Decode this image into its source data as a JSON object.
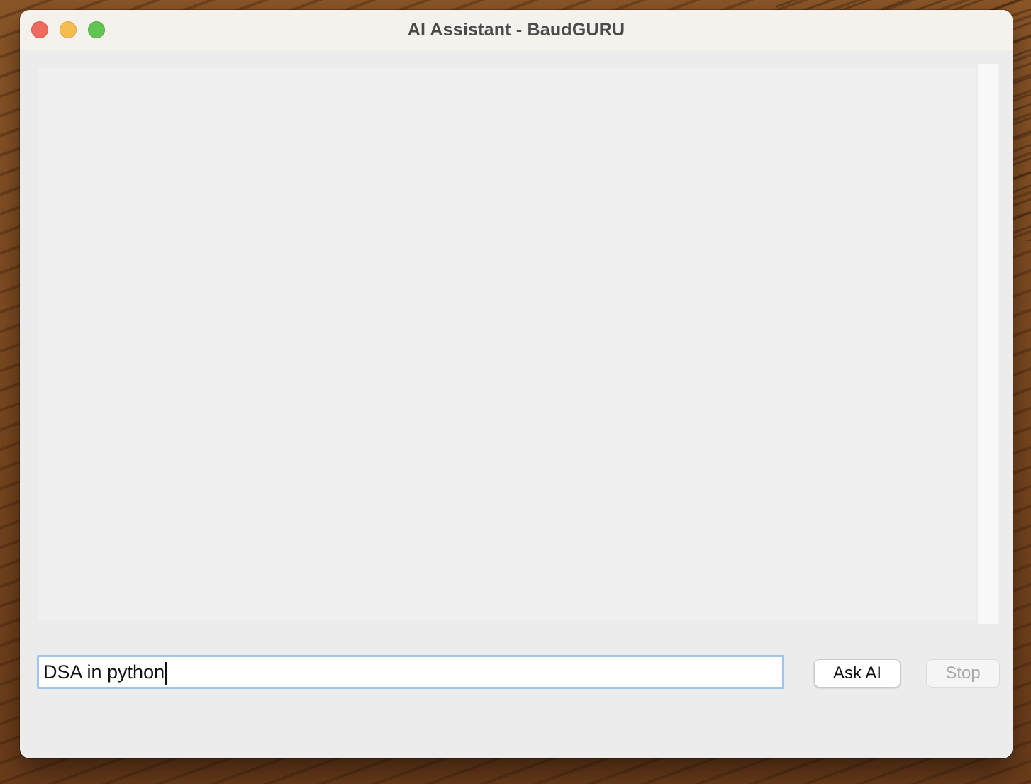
{
  "window": {
    "title": "AI Assistant - BaudGURU"
  },
  "output": {
    "text": ""
  },
  "input": {
    "value": "DSA in python"
  },
  "buttons": {
    "ask_label": "Ask AI",
    "stop_label": "Stop",
    "stop_enabled": false
  },
  "colors": {
    "close": "#ee6a5f",
    "minimize": "#f5bd4f",
    "zoom": "#61c554",
    "input_focus_ring": "#a3c2ee"
  }
}
